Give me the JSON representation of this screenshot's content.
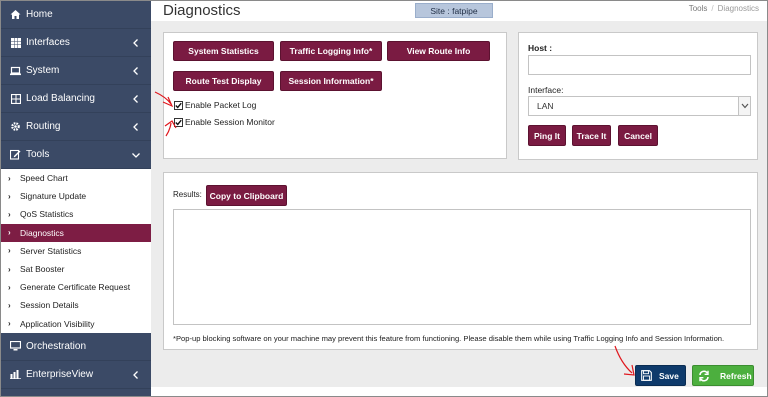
{
  "sidebar": {
    "items": [
      {
        "label": "Home",
        "icon": "home-icon"
      },
      {
        "label": "Interfaces",
        "icon": "grid-icon"
      },
      {
        "label": "System",
        "icon": "laptop-icon"
      },
      {
        "label": "Load Balancing",
        "icon": "server-icon"
      },
      {
        "label": "Routing",
        "icon": "gear-icon"
      },
      {
        "label": "Tools",
        "icon": "edit-icon"
      }
    ],
    "tools_subitems": [
      "Speed Chart",
      "Signature Update",
      "QoS Statistics",
      "Diagnostics",
      "Server Statistics",
      "Sat Booster",
      "Generate Certificate Request",
      "Session Details",
      "Application Visibility"
    ],
    "bottom_items": [
      {
        "label": "Orchestration",
        "icon": "monitor-icon"
      },
      {
        "label": "EnterpriseView",
        "icon": "chart-icon"
      }
    ]
  },
  "header": {
    "title": "Diagnostics",
    "site": "Site : fatpipe",
    "breadcrumb": [
      "Tools",
      "Diagnostics"
    ]
  },
  "diagnostics": {
    "buttons": [
      "System Statistics",
      "Traffic Logging Info*",
      "View Route Info",
      "Route Test Display",
      "Session Information*"
    ],
    "checkboxes": [
      {
        "label": "Enable Packet Log",
        "checked": true
      },
      {
        "label": "Enable Session Monitor",
        "checked": true
      }
    ]
  },
  "host_panel": {
    "host_label": "Host :",
    "host_value": "",
    "interface_label": "Interface:",
    "interface_value": "LAN",
    "buttons": [
      "Ping It",
      "Trace It",
      "Cancel"
    ]
  },
  "results": {
    "label": "Results:",
    "copy_button": "Copy to Clipboard",
    "value": "",
    "note": "*Pop-up blocking software on your machine may prevent this feature from functioning. Please disable them while using Traffic Logging Info and Session Information."
  },
  "footer": {
    "save_label": "Save",
    "refresh_label": "Refresh"
  },
  "colors": {
    "sidebar_bg": "#3b4a66",
    "accent": "#7a1b42",
    "save": "#0e3a6b",
    "refresh": "#4caf3e",
    "annotation": "#e0181e"
  }
}
